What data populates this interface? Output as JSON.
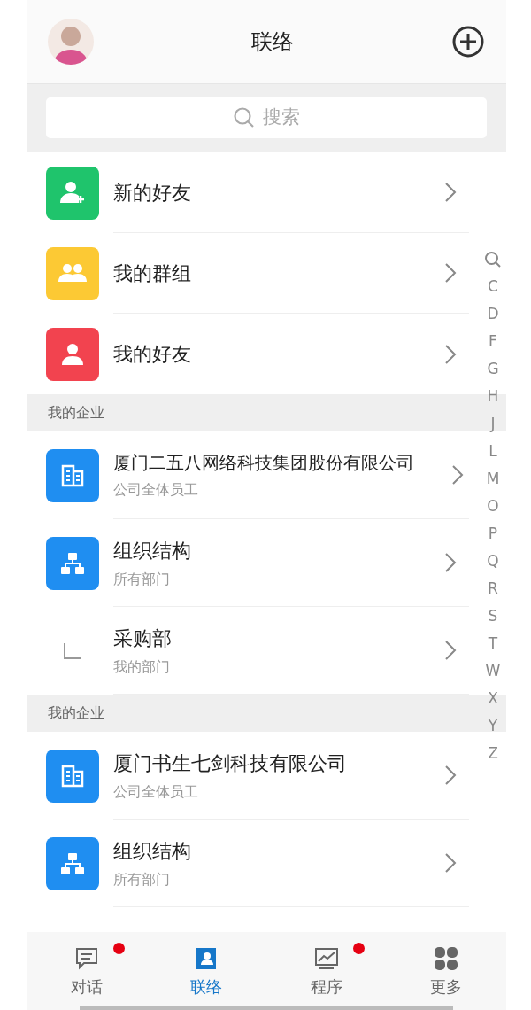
{
  "header": {
    "title": "联络"
  },
  "search": {
    "placeholder": "搜索"
  },
  "menu": [
    {
      "kind": "add-user",
      "color": "#1fc46c",
      "label": "新的好友"
    },
    {
      "kind": "group",
      "color": "#fcc934",
      "label": "我的群组"
    },
    {
      "kind": "user",
      "color": "#f2434f",
      "label": "我的好友"
    }
  ],
  "sections": [
    {
      "title": "我的企业",
      "items": [
        {
          "kind": "building",
          "color": "#1f8ef1",
          "label": "厦门二五八网络科技集团股份有限公司",
          "sub": "公司全体员工"
        },
        {
          "kind": "org",
          "color": "#1f8ef1",
          "label": "组织结构",
          "sub": "所有部门"
        },
        {
          "kind": "corner",
          "label": "采购部",
          "sub": "我的部门"
        }
      ]
    },
    {
      "title": "我的企业",
      "items": [
        {
          "kind": "building",
          "color": "#1f8ef1",
          "label": "厦门书生七剑科技有限公司",
          "sub": "公司全体员工"
        },
        {
          "kind": "org",
          "color": "#1f8ef1",
          "label": "组织结构",
          "sub": "所有部门"
        }
      ]
    }
  ],
  "index": [
    "C",
    "D",
    "F",
    "G",
    "H",
    "J",
    "L",
    "M",
    "O",
    "P",
    "Q",
    "R",
    "S",
    "T",
    "W",
    "X",
    "Y",
    "Z"
  ],
  "tabs": [
    {
      "kind": "chat",
      "label": "对话",
      "selected": false,
      "dot": true
    },
    {
      "kind": "contacts",
      "label": "联络",
      "selected": true,
      "dot": false
    },
    {
      "kind": "chart",
      "label": "程序",
      "selected": false,
      "dot": true
    },
    {
      "kind": "grid",
      "label": "更多",
      "selected": false,
      "dot": false
    }
  ]
}
